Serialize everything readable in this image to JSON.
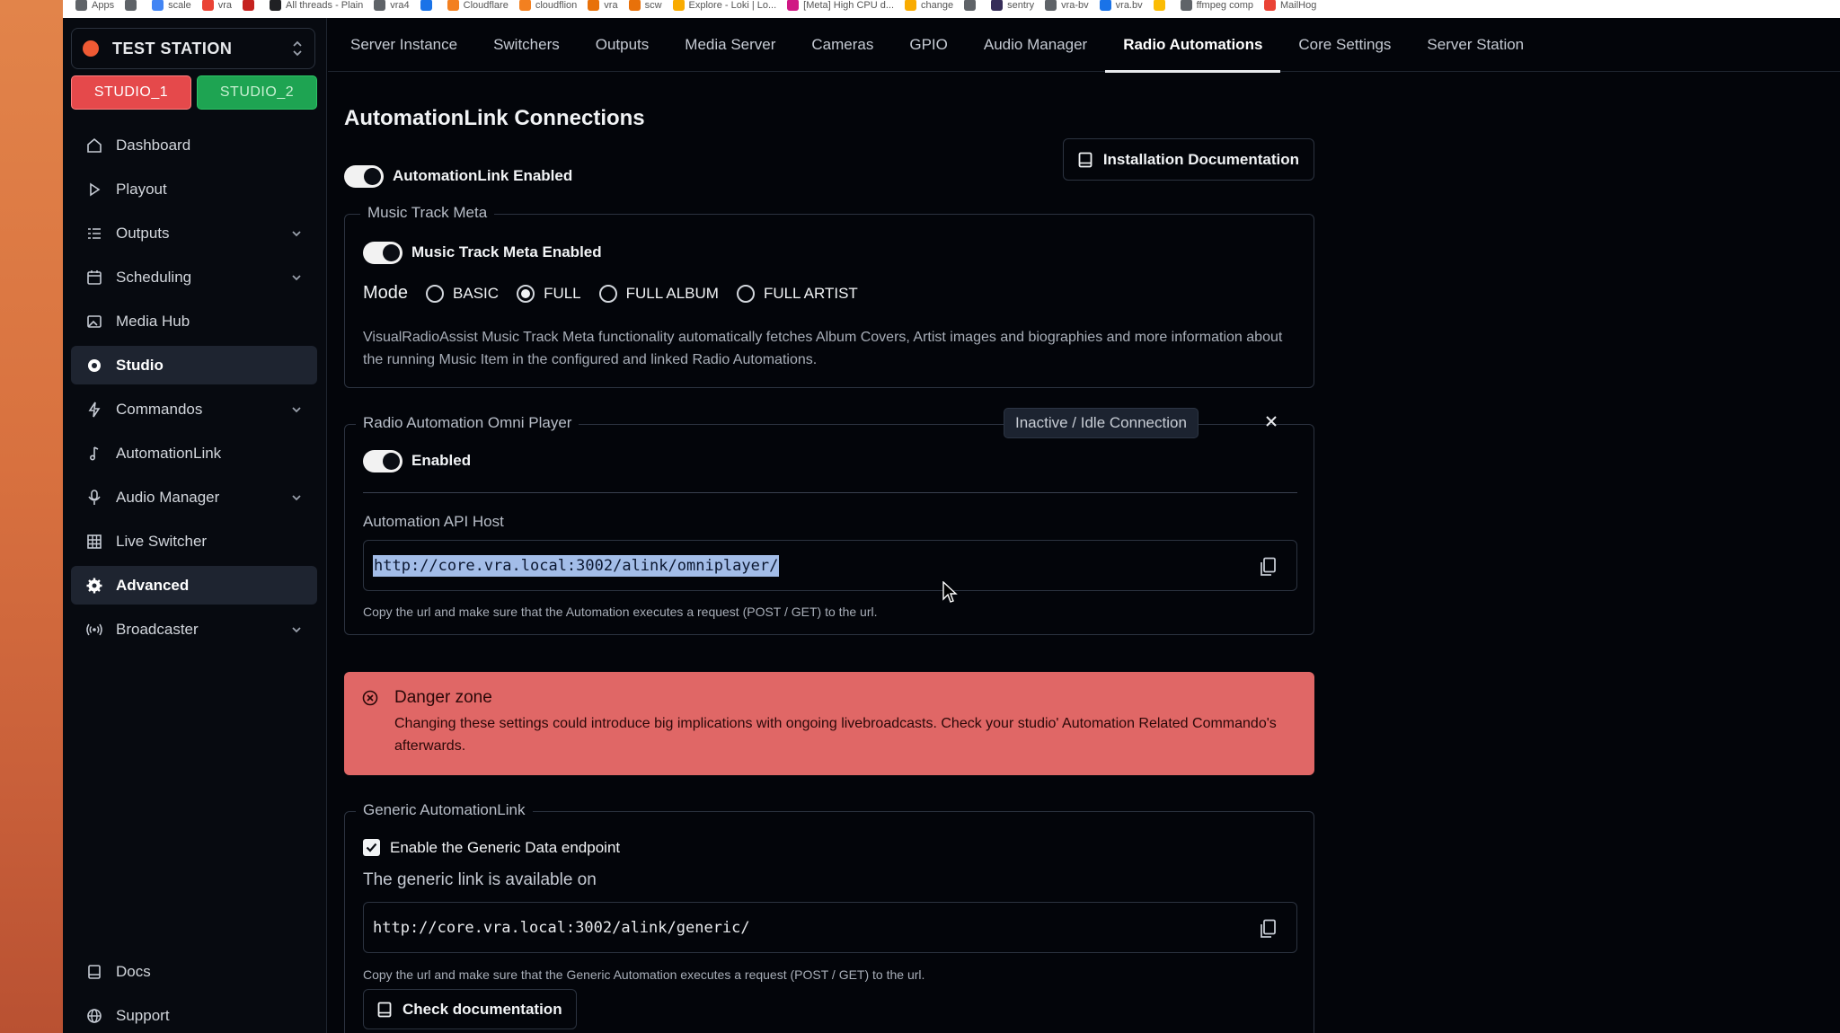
{
  "bookmarks": [
    {
      "label": "Apps",
      "color": "#5f6368"
    },
    {
      "label": "",
      "color": "#5f6368"
    },
    {
      "label": "scale",
      "color": "#4285f4"
    },
    {
      "label": "vra",
      "color": "#ea4335"
    },
    {
      "label": "",
      "color": "#c5221f"
    },
    {
      "label": "All threads - Plain",
      "color": "#202124"
    },
    {
      "label": "vra4",
      "color": "#5f6368"
    },
    {
      "label": "",
      "color": "#1a73e8"
    },
    {
      "label": "Cloudflare",
      "color": "#f38020"
    },
    {
      "label": "cloudflion",
      "color": "#f38020"
    },
    {
      "label": "vra",
      "color": "#e8710a"
    },
    {
      "label": "scw",
      "color": "#e8710a"
    },
    {
      "label": "Explore - Loki | Lo...",
      "color": "#f9ab00"
    },
    {
      "label": "[Meta] High CPU d...",
      "color": "#d01884"
    },
    {
      "label": "change",
      "color": "#f9ab00"
    },
    {
      "label": "",
      "color": "#5f6368"
    },
    {
      "label": "sentry",
      "color": "#362d59"
    },
    {
      "label": "vra-bv",
      "color": "#5f6368"
    },
    {
      "label": "vra.bv",
      "color": "#1a73e8"
    },
    {
      "label": "",
      "color": "#fbbc04"
    },
    {
      "label": "ffmpeg comp",
      "color": "#5f6368"
    },
    {
      "label": "MailHog",
      "color": "#ea4335"
    }
  ],
  "station": {
    "name": "TEST STATION",
    "dot_color": "#ef5a34"
  },
  "studios": [
    {
      "label": "STUDIO_1",
      "color": "#e5494b"
    },
    {
      "label": "STUDIO_2",
      "color": "#1ea452"
    }
  ],
  "nav": {
    "items": [
      {
        "label": "Dashboard",
        "icon": "home-icon"
      },
      {
        "label": "Playout",
        "icon": "play-icon"
      },
      {
        "label": "Outputs",
        "icon": "list-icon",
        "expandable": true
      },
      {
        "label": "Scheduling",
        "icon": "calendar-icon",
        "expandable": true
      },
      {
        "label": "Media Hub",
        "icon": "image-icon"
      },
      {
        "label": "Studio",
        "icon": "record-icon",
        "active": true
      },
      {
        "label": "Commandos",
        "icon": "bolt-icon",
        "expandable": true
      },
      {
        "label": "AutomationLink",
        "icon": "music-note-icon"
      },
      {
        "label": "Audio Manager",
        "icon": "microphone-icon",
        "expandable": true
      },
      {
        "label": "Live Switcher",
        "icon": "grid-icon"
      },
      {
        "label": "Advanced",
        "icon": "gear-icon",
        "active": true
      },
      {
        "label": "Broadcaster",
        "icon": "broadcast-icon",
        "expandable": true
      }
    ],
    "bottom": [
      {
        "label": "Docs",
        "icon": "book-icon"
      },
      {
        "label": "Support",
        "icon": "globe-icon"
      }
    ]
  },
  "tabs": [
    {
      "label": "Server Instance"
    },
    {
      "label": "Switchers"
    },
    {
      "label": "Outputs"
    },
    {
      "label": "Media Server"
    },
    {
      "label": "Cameras"
    },
    {
      "label": "GPIO"
    },
    {
      "label": "Audio Manager"
    },
    {
      "label": "Radio Automations",
      "active": true
    },
    {
      "label": "Core Settings"
    },
    {
      "label": "Server Station"
    }
  ],
  "page": {
    "title": "AutomationLink Connections",
    "enabled_label": "AutomationLink Enabled",
    "enabled": true,
    "install_doc_label": "Installation Documentation"
  },
  "music_meta": {
    "legend": "Music Track Meta",
    "toggle_label": "Music Track Meta Enabled",
    "enabled": true,
    "mode_label": "Mode",
    "modes": [
      "BASIC",
      "FULL",
      "FULL ALBUM",
      "FULL ARTIST"
    ],
    "selected_mode": "FULL",
    "description": "VisualRadioAssist Music Track Meta functionality automatically fetches Album Covers, Artist images and biographies and more information about the running Music Item in the configured and linked Radio Automations."
  },
  "omni": {
    "legend": "Radio Automation Omni Player",
    "status": "Inactive / Idle Connection",
    "toggle_label": "Enabled",
    "enabled": true,
    "api_host_label": "Automation API Host",
    "url": "http://core.vra.local:3002/alink/omniplayer/",
    "help": "Copy the url and make sure that the Automation executes a request (POST / GET) to the url."
  },
  "danger": {
    "title": "Danger zone",
    "body": "Changing these settings could introduce big implications with ongoing livebroadcasts. Check your studio' Automation Related Commando's afterwards.",
    "color": "#e06766"
  },
  "generic": {
    "legend": "Generic AutomationLink",
    "checkbox_label": "Enable the Generic Data endpoint",
    "checked": true,
    "available_label": "The generic link is available on",
    "url": "http://core.vra.local:3002/alink/generic/",
    "help": "Copy the url and make sure that the Generic Automation executes a request (POST / GET) to the url.",
    "check_doc_label": "Check documentation"
  }
}
